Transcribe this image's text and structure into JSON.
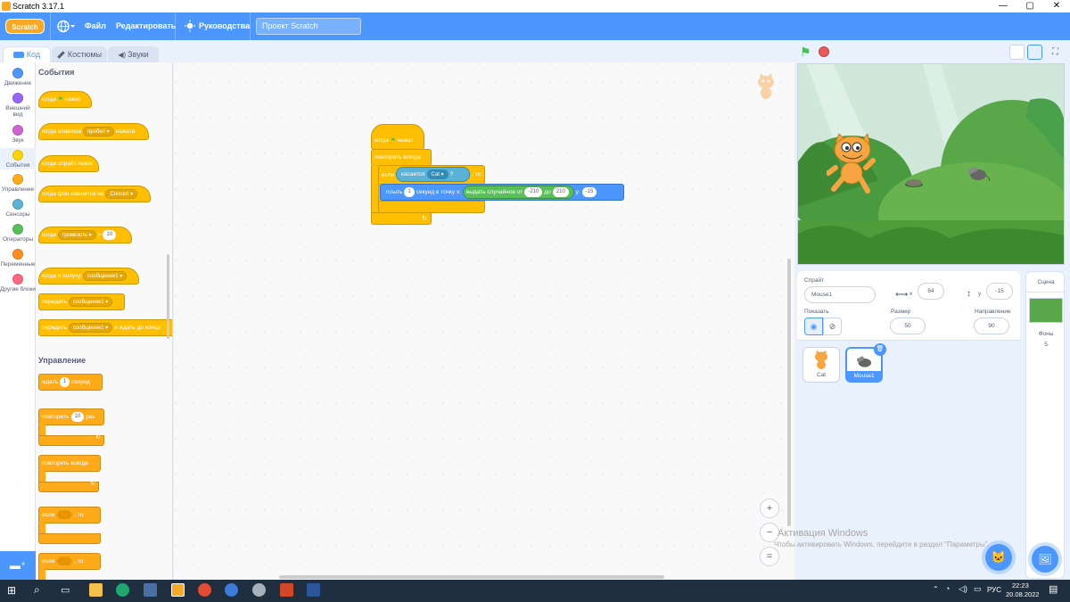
{
  "window": {
    "title": "Scratch 3.17.1",
    "minimize": "—",
    "maximize": "▢",
    "close": "✕"
  },
  "menu": {
    "logo": "Scratch",
    "file": "Файл",
    "edit": "Редактировать",
    "tutorials": "Руководства",
    "project_name": "Проект Scratch"
  },
  "tabs": {
    "code": "Код",
    "costumes": "Костюмы",
    "sounds": "Звуки"
  },
  "categories": [
    {
      "label": "Движение",
      "color": "#4c97ff"
    },
    {
      "label": "Внешний вид",
      "color": "#9966ff"
    },
    {
      "label": "Звук",
      "color": "#cf63cf"
    },
    {
      "label": "События",
      "color": "#ffd500"
    },
    {
      "label": "Управление",
      "color": "#ffab19"
    },
    {
      "label": "Сенсоры",
      "color": "#5cb1d6"
    },
    {
      "label": "Операторы",
      "color": "#59c059"
    },
    {
      "label": "Переменные",
      "color": "#ff8c1a"
    },
    {
      "label": "Другие блоки",
      "color": "#ff6680"
    }
  ],
  "palette": {
    "events_header": "События",
    "control_header": "Управление",
    "b_when_flag_pre": "когда",
    "b_when_flag_post": "нажат",
    "b_when_key_pre": "когда клавиша",
    "b_when_key_drop": "пробел ▾",
    "b_when_key_post": "нажата",
    "b_when_sprite": "когда спрайт нажат",
    "b_when_backdrop_pre": "когда фон сменится на",
    "b_when_backdrop_drop": "Concert ▾",
    "b_when_loud_pre": "когда",
    "b_when_loud_drop": "громкость ▾",
    "b_when_loud_gt": ">",
    "b_when_loud_val": "10",
    "b_receive_pre": "когда я получу",
    "b_receive_drop": "сообщение1 ▾",
    "b_broadcast_pre": "передать",
    "b_broadcast_drop": "сообщение1 ▾",
    "b_broadcast_wait_pre": "передать",
    "b_broadcast_wait_drop": "сообщение1 ▾",
    "b_broadcast_wait_post": "и ждать до конца",
    "b_wait_pre": "ждать",
    "b_wait_val": "1",
    "b_wait_post": "секунд",
    "b_repeat_pre": "повторить",
    "b_repeat_val": "10",
    "b_repeat_post": "раз",
    "b_forever": "повторять всегда",
    "b_if_pre": "если",
    "b_if_post": ", то",
    "b_if2_pre": "если",
    "b_if2_post": ", то"
  },
  "script": {
    "hat_pre": "когда",
    "hat_post": "нажат",
    "forever": "повторять всегда",
    "if_pre": "если",
    "if_post": ", то",
    "touching": "касается",
    "touching_drop": "Cat ▾",
    "touching_q": "?",
    "glide_pre": "плыть",
    "glide_secs": "1",
    "glide_mid": "секунд в точку x:",
    "random_pre": "выдать случайное от",
    "random_from": "-210",
    "random_to_lbl": "до",
    "random_to": "210",
    "y_lbl": "y:",
    "y_val": "-15"
  },
  "zoom": {
    "in": "+",
    "out": "−",
    "reset": "="
  },
  "sprite_info": {
    "sprite_label": "Спрайт",
    "sprite_name": "Mouse1",
    "x_label": "x",
    "x_value": "84",
    "y_label": "y",
    "y_value": "-15",
    "show_label": "Показать",
    "size_label": "Размер",
    "size_value": "50",
    "direction_label": "Направление",
    "direction_value": "90"
  },
  "sprites": [
    {
      "name": "Cat"
    },
    {
      "name": "Mouse1"
    }
  ],
  "stage_pane": {
    "title": "Сцена",
    "backdrops_label": "Фоны",
    "backdrops_count": "5"
  },
  "watermark": {
    "line1": "Активация Windows",
    "line2": "Чтобы активировать Windows, перейдите в раздел \"Параметры\"."
  },
  "taskbar": {
    "lang": "РУС",
    "time": "22:23",
    "date": "20.08.2022"
  }
}
